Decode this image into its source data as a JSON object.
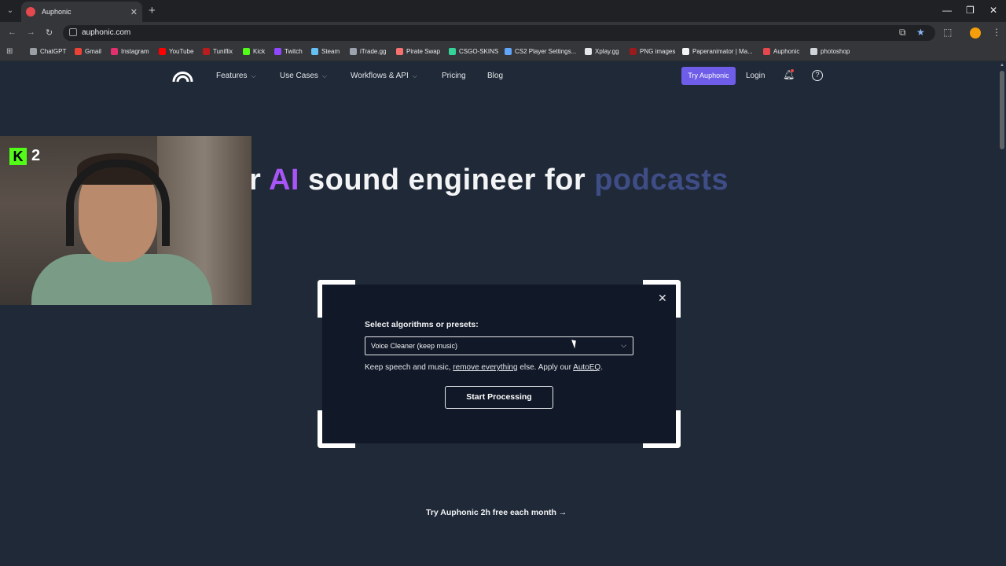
{
  "browser": {
    "tab_title": "Auphonic",
    "new_tab": "+",
    "tab_close": "✕",
    "url": "auphonic.com",
    "bookmarks": [
      {
        "label": "ChatGPT",
        "color": "#9aa0a6"
      },
      {
        "label": "Gmail",
        "color": "#ea4335"
      },
      {
        "label": "Instagram",
        "color": "#e1306c"
      },
      {
        "label": "YouTube",
        "color": "#ff0000"
      },
      {
        "label": "Tuniflix",
        "color": "#b91c1c"
      },
      {
        "label": "Kick",
        "color": "#53fc18"
      },
      {
        "label": "Twitch",
        "color": "#9146ff"
      },
      {
        "label": "Steam",
        "color": "#66c0f4"
      },
      {
        "label": "iTrade.gg",
        "color": "#9ca3af"
      },
      {
        "label": "Pirate Swap",
        "color": "#f87171"
      },
      {
        "label": "CSGO-SKINS",
        "color": "#34d399"
      },
      {
        "label": "CS2 Player Settings...",
        "color": "#60a5fa"
      },
      {
        "label": "Xplay.gg",
        "color": "#e5e7eb"
      },
      {
        "label": "PNG images",
        "color": "#991b1b"
      },
      {
        "label": "Paperanimator | Ma...",
        "color": "#f3f4f6"
      },
      {
        "label": "Auphonic",
        "color": "#e5484d"
      },
      {
        "label": "photoshop",
        "color": "#d1d5db"
      }
    ]
  },
  "site": {
    "nav": {
      "features": "Features",
      "use_cases": "Use Cases",
      "workflows": "Workflows & API",
      "pricing": "Pricing",
      "blog": "Blog",
      "try": "Try Auphonic",
      "login": "Login",
      "help": "?"
    },
    "headline": {
      "part1": "r ",
      "ai": "AI",
      "part2": " sound engineer for ",
      "rotating": "podcasts"
    },
    "modal": {
      "label": "Select algorithms or presets:",
      "selected": "Voice Cleaner (keep music)",
      "desc_start": "Keep speech and music, ",
      "desc_link1": "remove everything",
      "desc_mid": " else. Apply our ",
      "desc_link2": "AutoEQ",
      "desc_end": ".",
      "start": "Start Processing",
      "close": "✕"
    },
    "cta": "Try Auphonic 2h free each month →"
  },
  "overlay": {
    "kick_letter": "K",
    "kick_count": "2"
  },
  "colors": {
    "accent": "#6d5de8",
    "ai": "#a855f7",
    "rotating": "#3f4d86",
    "bg": "#1f2937"
  }
}
